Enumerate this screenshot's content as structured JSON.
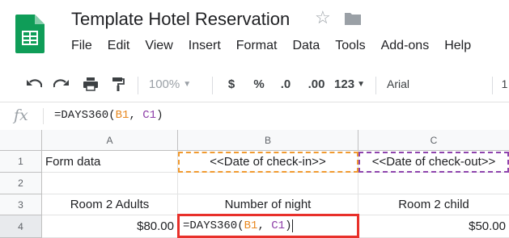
{
  "app": {
    "title": "Template Hotel Reservation",
    "icons": [
      "sheets-logo-icon",
      "star-icon",
      "folder-icon"
    ]
  },
  "menu": [
    "File",
    "Edit",
    "View",
    "Insert",
    "Format",
    "Data",
    "Tools",
    "Add-ons",
    "Help"
  ],
  "toolbar": {
    "zoom": "100%",
    "currency": "$",
    "percent": "%",
    "decrease_decimals": ".0",
    "increase_decimals": ".00",
    "more_formats": "123",
    "font": "Arial",
    "font_size_partial": "1"
  },
  "formula_bar": {
    "fx": "fx",
    "prefix": "=DAYS360(",
    "ref1": "B1",
    "sep": ", ",
    "ref2": "C1",
    "suffix": ")"
  },
  "columns": [
    "A",
    "B",
    "C"
  ],
  "rows": [
    "1",
    "2",
    "3",
    "4"
  ],
  "cells": {
    "A1": "Form data",
    "B1": "<<Date of check-in>>",
    "C1": "<<Date of check-out>>",
    "A3": "Room 2 Adults",
    "B3": "Number of night",
    "C3": "Room 2 child",
    "A4": "$80.00",
    "C4": "$50.00"
  },
  "editing_cell": {
    "prefix": "=DAYS360(",
    "ref1": "B1",
    "sep": ", ",
    "ref2": "C1",
    "suffix": ")"
  },
  "colors": {
    "ref_b": "#e8871e",
    "ref_c": "#8e3ea8",
    "highlight_border": "#e8302a",
    "sheets_green": "#0f9d58"
  }
}
